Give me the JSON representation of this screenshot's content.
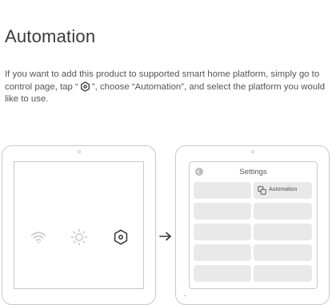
{
  "heading": "Automation",
  "intro": {
    "before": "If you want to add this product to supported smart home platform, simply go to control page, tap “",
    "after": "”, choose “Automation”, and select the platform you would like to use."
  },
  "left_device": {
    "icons": [
      "wifi-icon",
      "sun-icon",
      "settings-hex-icon"
    ]
  },
  "right_device": {
    "title": "Settings",
    "automation_label": "Automation",
    "back_icon": "back-icon",
    "automation_icon": "automation-icon"
  },
  "colors": {
    "outline": "#c9c9c9",
    "tile": "#e9e9e9",
    "icon_light": "#c8c8c8",
    "icon_dark": "#333333"
  }
}
